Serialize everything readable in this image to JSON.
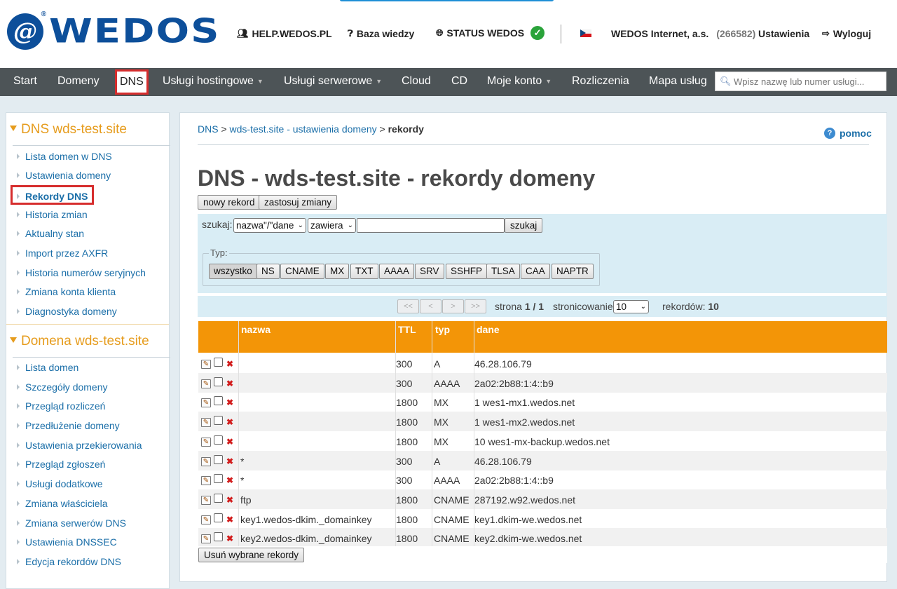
{
  "header": {
    "logo_text": "WEDOS",
    "logo_mark": "@",
    "links": {
      "help": "HELP.WEDOS.PL",
      "kb": "Baza wiedzy",
      "status": "STATUS WEDOS",
      "company": "WEDOS Internet, a.s.",
      "company_id": "(266582)",
      "settings": "Ustawienia",
      "logout": "Wyloguj"
    }
  },
  "nav": {
    "items": [
      "Start",
      "Domeny",
      "DNS",
      "Usługi hostingowe",
      "Usługi serwerowe",
      "Cloud",
      "CD",
      "Moje konto",
      "Rozliczenia",
      "Mapa usług"
    ],
    "search_placeholder": "Wpisz nazwę lub numer usługi..."
  },
  "sidebar": {
    "section1_title": "DNS wds-test.site",
    "section1_items": [
      "Lista domen w DNS",
      "Ustawienia domeny",
      "Rekordy DNS",
      "Historia zmian",
      "Aktualny stan",
      "Import przez AXFR",
      "Historia numerów seryjnych",
      "Zmiana konta klienta",
      "Diagnostyka domeny"
    ],
    "section2_title": "Domena wds-test.site",
    "section2_items": [
      "Lista domen",
      "Szczegóły domeny",
      "Przegląd rozliczeń",
      "Przedłużenie domeny",
      "Ustawienia przekierowania",
      "Przegląd zgłoszeń",
      "Usługi dodatkowe",
      "Zmiana właściciela",
      "Zmiana serwerów DNS",
      "Ustawienia DNSSEC",
      "Edycja rekordów DNS"
    ]
  },
  "main": {
    "breadcrumb": {
      "part1": "DNS",
      "sep": " > ",
      "part2": "wds-test.site - ustawienia domeny",
      "part3": "rekordy"
    },
    "help": "pomoc",
    "title": "DNS - wds-test.site - rekordy domeny",
    "btn_new": "nowy rekord",
    "btn_apply": "zastosuj zmiany",
    "search": {
      "label": "szukaj:",
      "field_select": "nazwa\"/\"dane",
      "mode_select": "zawiera",
      "value": "",
      "btn": "szukaj"
    },
    "type_legend": "Typ:",
    "types": [
      "wszystko",
      "NS",
      "CNAME",
      "MX",
      "TXT",
      "AAAA",
      "SRV",
      "SSHFP",
      "TLSA",
      "CAA",
      "NAPTR"
    ],
    "pagination": {
      "first": "<<",
      "prev": "<",
      "next": ">",
      "last": ">>",
      "page_label": "strona",
      "page_value": "1 / 1",
      "per_page_label": "stronicowanie:",
      "per_page_value": "10",
      "records_label": "rekordów:",
      "records_value": "10"
    },
    "table": {
      "headers": {
        "name": "nazwa",
        "ttl": "TTL",
        "type": "typ",
        "data": "dane"
      },
      "rows": [
        {
          "name": "",
          "ttl": "300",
          "type": "A",
          "data": "46.28.106.79"
        },
        {
          "name": "",
          "ttl": "300",
          "type": "AAAA",
          "data": "2a02:2b88:1:4::b9"
        },
        {
          "name": "",
          "ttl": "1800",
          "type": "MX",
          "data": "1 wes1-mx1.wedos.net"
        },
        {
          "name": "",
          "ttl": "1800",
          "type": "MX",
          "data": "1 wes1-mx2.wedos.net"
        },
        {
          "name": "",
          "ttl": "1800",
          "type": "MX",
          "data": "10 wes1-mx-backup.wedos.net"
        },
        {
          "name": "*",
          "ttl": "300",
          "type": "A",
          "data": "46.28.106.79"
        },
        {
          "name": "*",
          "ttl": "300",
          "type": "AAAA",
          "data": "2a02:2b88:1:4::b9"
        },
        {
          "name": "ftp",
          "ttl": "1800",
          "type": "CNAME",
          "data": "287192.w92.wedos.net"
        },
        {
          "name": "key1.wedos-dkim._domainkey",
          "ttl": "1800",
          "type": "CNAME",
          "data": "key1.dkim-we.wedos.net"
        },
        {
          "name": "key2.wedos-dkim._domainkey",
          "ttl": "1800",
          "type": "CNAME",
          "data": "key2.dkim-we.wedos.net"
        }
      ]
    },
    "btn_delete_selected": "Usuń wybrane rekordy"
  },
  "colors": {
    "brand_blue": "#0d4f9a",
    "nav_bg": "#4d5457",
    "accent_orange": "#f39507",
    "sidebar_title": "#e69c1d",
    "link": "#1a6ea8",
    "highlight_red": "#d62d2d",
    "status_green": "#2aa33a"
  }
}
